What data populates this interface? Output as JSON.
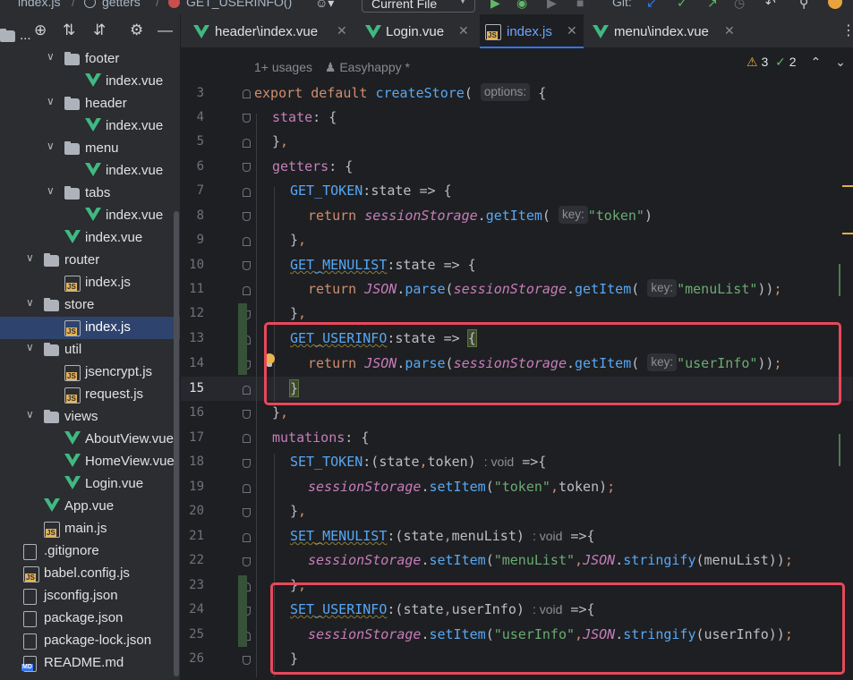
{
  "topbar": {
    "crumb_file": "index.js",
    "crumb_section": "getters",
    "crumb_method": "GET_USERINFO()",
    "run_config": "Current File",
    "git_label": "Git:"
  },
  "sidebar": {
    "tree": [
      {
        "label": "...",
        "type": "folder",
        "depth": 0
      },
      {
        "label": "footer",
        "type": "folder",
        "expanded": true,
        "depth": 3
      },
      {
        "label": "index.vue",
        "type": "vue",
        "depth": 4
      },
      {
        "label": "header",
        "type": "folder",
        "expanded": true,
        "depth": 3
      },
      {
        "label": "index.vue",
        "type": "vue",
        "depth": 4
      },
      {
        "label": "menu",
        "type": "folder",
        "expanded": true,
        "depth": 3
      },
      {
        "label": "index.vue",
        "type": "vue",
        "depth": 4
      },
      {
        "label": "tabs",
        "type": "folder",
        "expanded": true,
        "depth": 3
      },
      {
        "label": "index.vue",
        "type": "vue",
        "depth": 4
      },
      {
        "label": "index.vue",
        "type": "vue",
        "depth": 3
      },
      {
        "label": "router",
        "type": "folder",
        "expanded": true,
        "depth": 2
      },
      {
        "label": "index.js",
        "type": "js",
        "depth": 3
      },
      {
        "label": "store",
        "type": "folder",
        "expanded": true,
        "depth": 2
      },
      {
        "label": "index.js",
        "type": "js",
        "depth": 3,
        "selected": true
      },
      {
        "label": "util",
        "type": "folder",
        "expanded": true,
        "depth": 2
      },
      {
        "label": "jsencrypt.js",
        "type": "js",
        "depth": 3
      },
      {
        "label": "request.js",
        "type": "js",
        "depth": 3
      },
      {
        "label": "views",
        "type": "folder",
        "expanded": true,
        "depth": 2
      },
      {
        "label": "AboutView.vue",
        "type": "vue",
        "depth": 3
      },
      {
        "label": "HomeView.vue",
        "type": "vue",
        "depth": 3
      },
      {
        "label": "Login.vue",
        "type": "vue",
        "depth": 3
      },
      {
        "label": "App.vue",
        "type": "vue",
        "depth": 2
      },
      {
        "label": "main.js",
        "type": "js",
        "depth": 2
      },
      {
        "label": ".gitignore",
        "type": "file",
        "depth": 1
      },
      {
        "label": "babel.config.js",
        "type": "js",
        "depth": 1
      },
      {
        "label": "jsconfig.json",
        "type": "file",
        "depth": 1
      },
      {
        "label": "package.json",
        "type": "file",
        "depth": 1
      },
      {
        "label": "package-lock.json",
        "type": "file",
        "depth": 1
      },
      {
        "label": "README.md",
        "type": "md",
        "depth": 1
      }
    ]
  },
  "tabs": [
    {
      "label": "header\\index.vue",
      "type": "vue",
      "active": false
    },
    {
      "label": "Login.vue",
      "type": "vue",
      "active": false
    },
    {
      "label": "index.js",
      "type": "js",
      "active": true
    },
    {
      "label": "menu\\index.vue",
      "type": "vue",
      "active": false
    }
  ],
  "editor": {
    "usages": "1+ usages",
    "author": "Easyhappy *",
    "warnings": "3",
    "checks": "2",
    "current_line": 15,
    "line_numbers": [
      3,
      4,
      5,
      6,
      7,
      8,
      9,
      10,
      11,
      12,
      13,
      14,
      15,
      16,
      17,
      18,
      19,
      20,
      21,
      22,
      23,
      24,
      25,
      26
    ],
    "hints": {
      "options": "options:",
      "key": "key:",
      "void": ": void"
    },
    "strings": {
      "token": "\"token\"",
      "menuList": "\"menuList\"",
      "userInfo": "\"userInfo\""
    }
  },
  "colors": {
    "accent": "#3574f0",
    "highlight_box": "#e8485b",
    "vue_green": "#41b883"
  }
}
